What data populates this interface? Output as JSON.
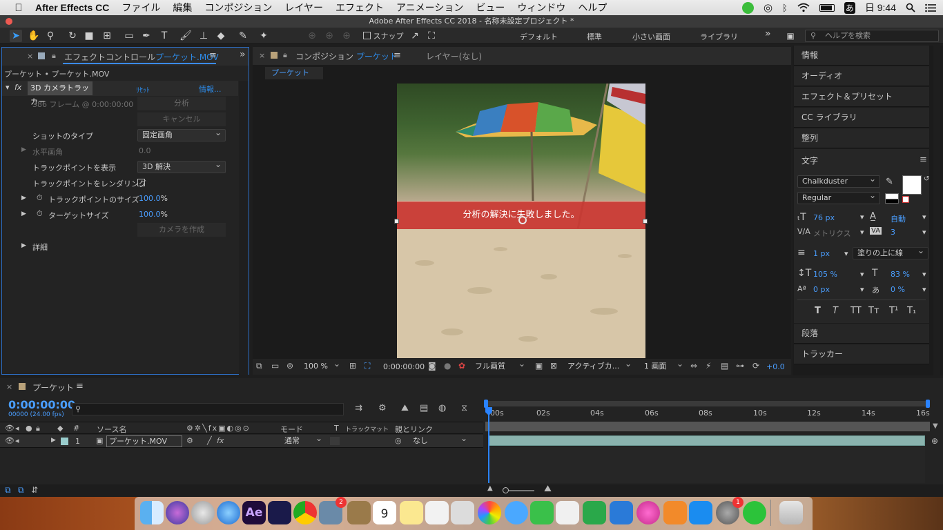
{
  "menubar": {
    "app_name": "After Effects CC",
    "items": [
      "ファイル",
      "編集",
      "コンポジション",
      "レイヤー",
      "エフェクト",
      "アニメーション",
      "ビュー",
      "ウィンドウ",
      "ヘルプ"
    ],
    "clock": "日 9:44",
    "ime": "あ"
  },
  "window": {
    "title": "Adobe After Effects CC 2018 - 名称未設定プロジェクト *"
  },
  "toolbar": {
    "snap_label": "スナップ",
    "workspaces": [
      "デフォルト",
      "標準",
      "小さい画面",
      "ライブラリ"
    ],
    "more": "»",
    "help_search_placeholder": "ヘルプを検索"
  },
  "effect_panel": {
    "tab_prefix": "エフェクトコントロール",
    "tab_layer": "プーケット.MOV",
    "breadcrumb": "プーケット • プーケット.MOV",
    "effect_name": "3D カメラトラッカー",
    "reset": "ﾘｾｯﾄ",
    "info": "情報...",
    "frames": "386 フレーム @ 0:00:00:00",
    "analyze": "分析",
    "cancel": "キャンセル",
    "shot_type_label": "ショットのタイプ",
    "shot_type_value": "固定画角",
    "fov_label": "水平画角",
    "fov_value": "0.0",
    "show_tp_label": "トラックポイントを表示",
    "show_tp_value": "3D 解決",
    "render_tp_label": "トラックポイントをレンダリング",
    "tp_size_label": "トラックポイントのサイズ",
    "tp_size_value": "100.0",
    "tp_size_unit": "%",
    "target_size_label": "ターゲットサイズ",
    "target_size_value": "100.0",
    "target_size_unit": "%",
    "create_camera": "カメラを作成",
    "details": "詳細"
  },
  "comp_panel": {
    "tab_prefix": "コンポジション",
    "tab_name": "プーケット",
    "layer_tab": "レイヤー(なし)",
    "subtab": "プーケット",
    "overlay_message": "分析の解決に失敗しました。",
    "zoom": "100 %",
    "timecode": "0:00:00:00",
    "quality": "フル画質",
    "camera": "アクティブカ...",
    "views": "1 画面",
    "exposure": "+0.0"
  },
  "right_panel": {
    "items_top": [
      "情報",
      "オーディオ",
      "エフェクト＆プリセット",
      "CC ライブラリ",
      "整列"
    ],
    "char_title": "文字",
    "font": "Chalkduster",
    "style": "Regular",
    "font_size": "76 px",
    "leading": "自動",
    "kerning": "メトリクス",
    "tracking": "3",
    "stroke": "1 px",
    "stroke_type": "塗りの上に線",
    "vscale": "105 %",
    "hscale": "83 %",
    "baseline": "0 px",
    "tsume": "0 %",
    "styles": [
      "T",
      "T",
      "TT",
      "Tт",
      "T¹",
      "T₁"
    ],
    "items_bottom": [
      "段落",
      "トラッカー"
    ]
  },
  "timeline": {
    "comp_name": "プーケット",
    "timecode": "0:00:00:00",
    "fps": "00000 (24.00 fps)",
    "col_source": "ソース名",
    "col_mode": "モード",
    "col_trkmat": "トラックマット",
    "col_parent": "親とリンク",
    "hash": "#",
    "ruler": [
      "00s",
      "02s",
      "04s",
      "06s",
      "08s",
      "10s",
      "12s",
      "14s",
      "16s"
    ],
    "layer": {
      "index": "1",
      "name": "プーケット.MOV",
      "mode": "通常",
      "parent": "なし"
    }
  },
  "dock": {
    "calendar_day": "9",
    "badge_count_1": "2",
    "badge_count_2": "1"
  }
}
